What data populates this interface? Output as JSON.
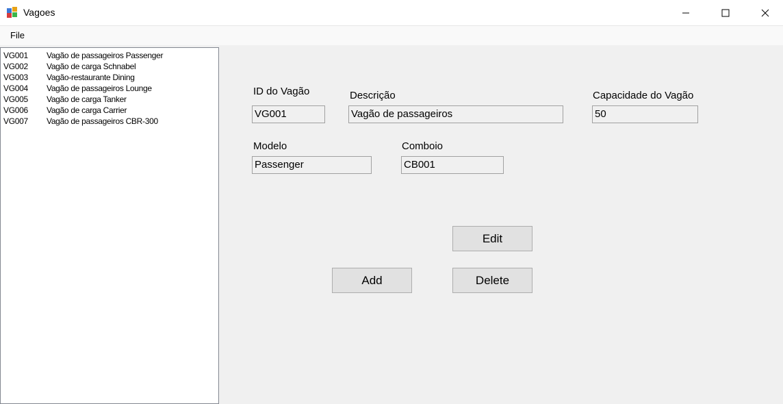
{
  "window": {
    "title": "Vagoes",
    "icons": {
      "app": "app-form-icon",
      "minimize": "minimize-icon",
      "maximize": "maximize-icon",
      "close": "close-icon"
    }
  },
  "menu": {
    "file": "File"
  },
  "list": {
    "items": [
      {
        "id": "VG001",
        "desc": "Vagão de passageiros Passenger"
      },
      {
        "id": "VG002",
        "desc": "Vagão de carga Schnabel"
      },
      {
        "id": "VG003",
        "desc": "Vagão-restaurante Dining"
      },
      {
        "id": "VG004",
        "desc": "Vagão de passageiros Lounge"
      },
      {
        "id": "VG005",
        "desc": "Vagão de carga Tanker"
      },
      {
        "id": "VG006",
        "desc": "Vagão de carga Carrier"
      },
      {
        "id": "VG007",
        "desc": "Vagão de passageiros CBR-300"
      }
    ]
  },
  "form": {
    "id_label": "ID do Vagão",
    "id_value": "VG001",
    "descricao_label": "Descrição",
    "descricao_value": "Vagão de passageiros",
    "capacidade_label": "Capacidade do Vagão",
    "capacidade_value": "50",
    "modelo_label": "Modelo",
    "modelo_value": "Passenger",
    "comboio_label": "Comboio",
    "comboio_value": "CB001"
  },
  "buttons": {
    "edit": "Edit",
    "add": "Add",
    "delete": "Delete"
  }
}
